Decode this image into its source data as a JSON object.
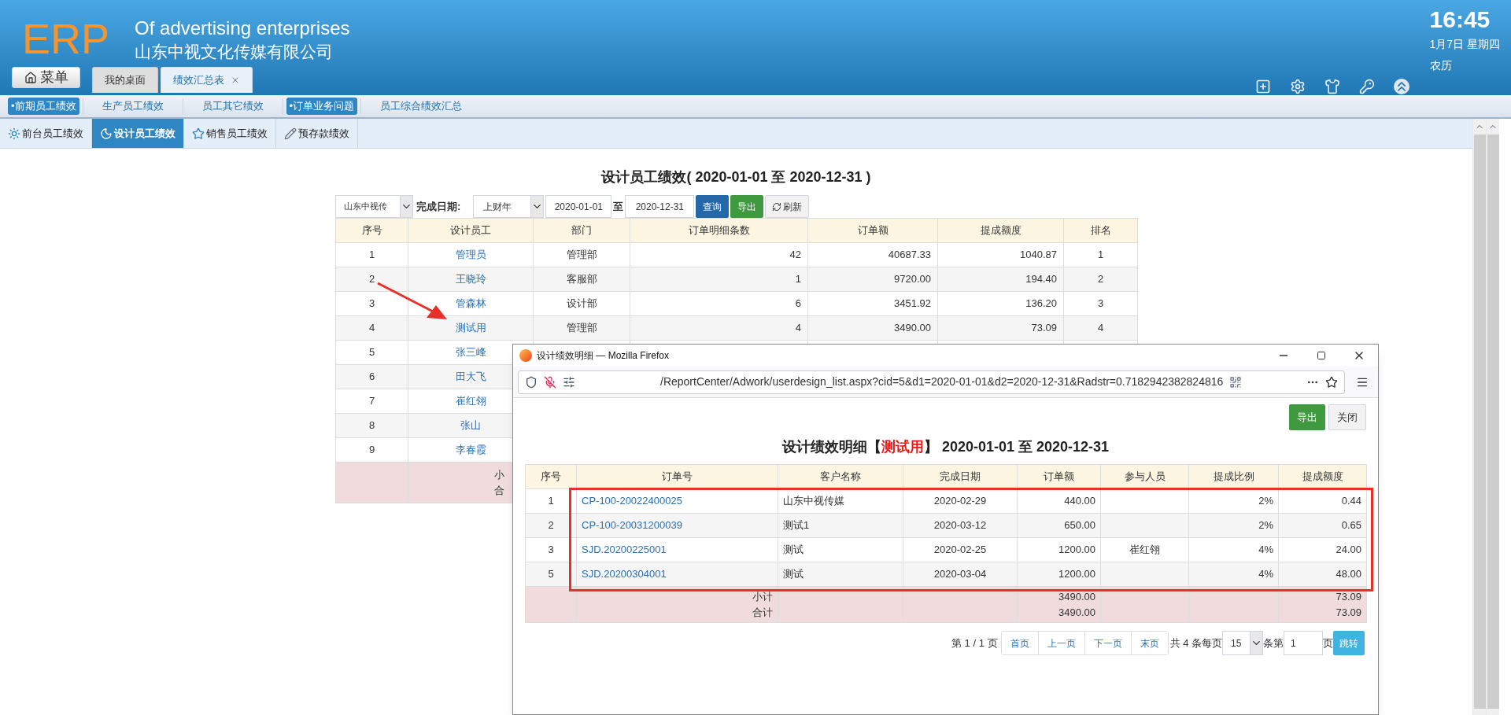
{
  "header": {
    "logo": "ERP",
    "title": "Of advertising enterprises",
    "company": "山东中视文化传媒有限公司",
    "menu_button": "菜单",
    "time": "16:45",
    "date": "1月7日 星期四",
    "lunar": "农历"
  },
  "top_tabs": [
    {
      "label": "我的桌面",
      "selected": false,
      "closable": false
    },
    {
      "label": "绩效汇总表",
      "selected": true,
      "closable": true
    }
  ],
  "nav_items": [
    {
      "label": "•前期员工绩效",
      "highlighted": true
    },
    {
      "label": "生产员工绩效",
      "highlighted": false
    },
    {
      "label": "员工其它绩效",
      "highlighted": false
    },
    {
      "label": "•订单业务问题",
      "highlighted": true
    },
    {
      "label": "员工综合绩效汇总",
      "highlighted": false
    }
  ],
  "sub_tabs": [
    {
      "label": "前台员工绩效",
      "selected": false
    },
    {
      "label": "设计员工绩效",
      "selected": true
    },
    {
      "label": "销售员工绩效",
      "selected": false
    },
    {
      "label": "预存款绩效",
      "selected": false
    }
  ],
  "report": {
    "title": "设计员工绩效( 2020-01-01 至 2020-12-31 )",
    "filters": {
      "company": "山东中视传",
      "date_label": "完成日期:",
      "period": "上财年",
      "start": "2020-01-01",
      "to": "至",
      "end": "2020-12-31",
      "query_button": "查询",
      "export_button": "导出",
      "refresh_button": "刷新"
    },
    "columns": [
      "序号",
      "设计员工",
      "部门",
      "订单明细条数",
      "订单额",
      "提成额度",
      "排名"
    ],
    "rows": [
      {
        "seq": "1",
        "name": "管理员",
        "dept": "管理部",
        "lines": "42",
        "amount": "40687.33",
        "commission": "1040.87",
        "rank": "1"
      },
      {
        "seq": "2",
        "name": "王晓玲",
        "dept": "客服部",
        "lines": "1",
        "amount": "9720.00",
        "commission": "194.40",
        "rank": "2"
      },
      {
        "seq": "3",
        "name": "管森林",
        "dept": "设计部",
        "lines": "6",
        "amount": "3451.92",
        "commission": "136.20",
        "rank": "3"
      },
      {
        "seq": "4",
        "name": "测试用",
        "dept": "管理部",
        "lines": "4",
        "amount": "3490.00",
        "commission": "73.09",
        "rank": "4"
      },
      {
        "seq": "5",
        "name": "张三峰"
      },
      {
        "seq": "6",
        "name": "田大飞"
      },
      {
        "seq": "7",
        "name": "崔红翎"
      },
      {
        "seq": "8",
        "name": "张山"
      },
      {
        "seq": "9",
        "name": "李春霞"
      }
    ],
    "summary_labels": [
      "小",
      "合"
    ]
  },
  "popup": {
    "window_title": "设计绩效明细 — Mozilla Firefox",
    "url": "/ReportCenter/Adwork/userdesign_list.aspx?cid=5&d1=2020-01-01&d2=2020-12-31&Radstr=0.7182942382824816",
    "export_button": "导出",
    "close_button": "关闭",
    "title_prefix": "设计绩效明细【",
    "title_highlight": "测试用",
    "title_suffix": "】 2020-01-01 至 2020-12-31",
    "columns": [
      "序号",
      "订单号",
      "客户名称",
      "完成日期",
      "订单额",
      "参与人员",
      "提成比例",
      "提成额度"
    ],
    "rows": [
      {
        "seq": "1",
        "order": "CP-100-20022400025",
        "customer": "山东中视传媒",
        "date": "2020-02-29",
        "amount": "440.00",
        "rate": "2%",
        "commission": "0.44"
      },
      {
        "seq": "2",
        "order": "CP-100-20031200039",
        "customer": "测试1",
        "date": "2020-03-12",
        "amount": "650.00",
        "rate": "2%",
        "commission": "0.65"
      },
      {
        "seq": "3",
        "order": "SJD.20200225001",
        "customer": "测试",
        "date": "2020-02-25",
        "amount": "1200.00",
        "participant": "崔红翎",
        "rate": "4%",
        "commission": "24.00"
      },
      {
        "seq": "5",
        "order": "SJD.20200304001",
        "customer": "测试",
        "date": "2020-03-04",
        "amount": "1200.00",
        "rate": "4%",
        "commission": "48.00"
      }
    ],
    "summary": [
      {
        "label": "小计",
        "amount": "3490.00",
        "commission": "73.09"
      },
      {
        "label": "合计",
        "amount": "3490.00",
        "commission": "73.09"
      }
    ],
    "pager": {
      "page_info": "第 1 / 1 页",
      "buttons": [
        "首页",
        "上一页",
        "下一页",
        "末页"
      ],
      "total": "共 4 条每页",
      "page_size": "15",
      "page_label": "条第",
      "page": "1",
      "page_suffix": "页",
      "go_button": "跳转"
    }
  }
}
